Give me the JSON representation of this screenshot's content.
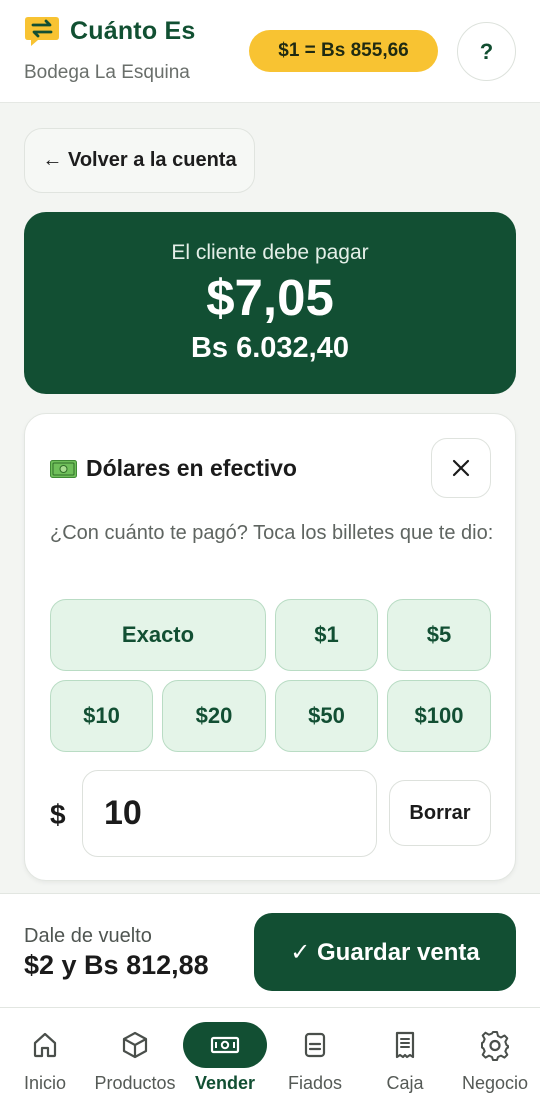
{
  "header": {
    "app_title": "Cuánto Es",
    "store_name": "Bodega La Esquina",
    "rate": "$1 = Bs 855,66",
    "help_label": "?"
  },
  "back": {
    "label": "← Volver a la cuenta"
  },
  "amount_due": {
    "label": "El cliente debe pagar",
    "usd": "$7,05",
    "bs": "Bs 6.032,40"
  },
  "payment": {
    "method_title": "Dólares en efectivo",
    "method_icon": "cash-icon",
    "question": "¿Con cuánto te pagó? Toca los billetes que te dio:",
    "bills": [
      "Exacto",
      "$1",
      "$5",
      "$10",
      "$20",
      "$50",
      "$100"
    ],
    "currency_symbol": "$",
    "entered_amount": "10",
    "clear_label": "Borrar"
  },
  "change": {
    "label": "Dale de vuelto",
    "value": "$2 y Bs 812,88",
    "save_label": "✓ Guardar venta"
  },
  "nav": {
    "items": [
      {
        "label": "Inicio",
        "icon": "home-icon"
      },
      {
        "label": "Productos",
        "icon": "box-icon"
      },
      {
        "label": "Vender",
        "icon": "cash-icon"
      },
      {
        "label": "Fiados",
        "icon": "notebook-icon"
      },
      {
        "label": "Caja",
        "icon": "receipt-icon"
      },
      {
        "label": "Negocio",
        "icon": "gear-icon"
      }
    ],
    "active": "Vender"
  },
  "colors": {
    "brand": "#124f33",
    "accent": "#f8c332",
    "bill_bg": "#e4f4e8"
  }
}
